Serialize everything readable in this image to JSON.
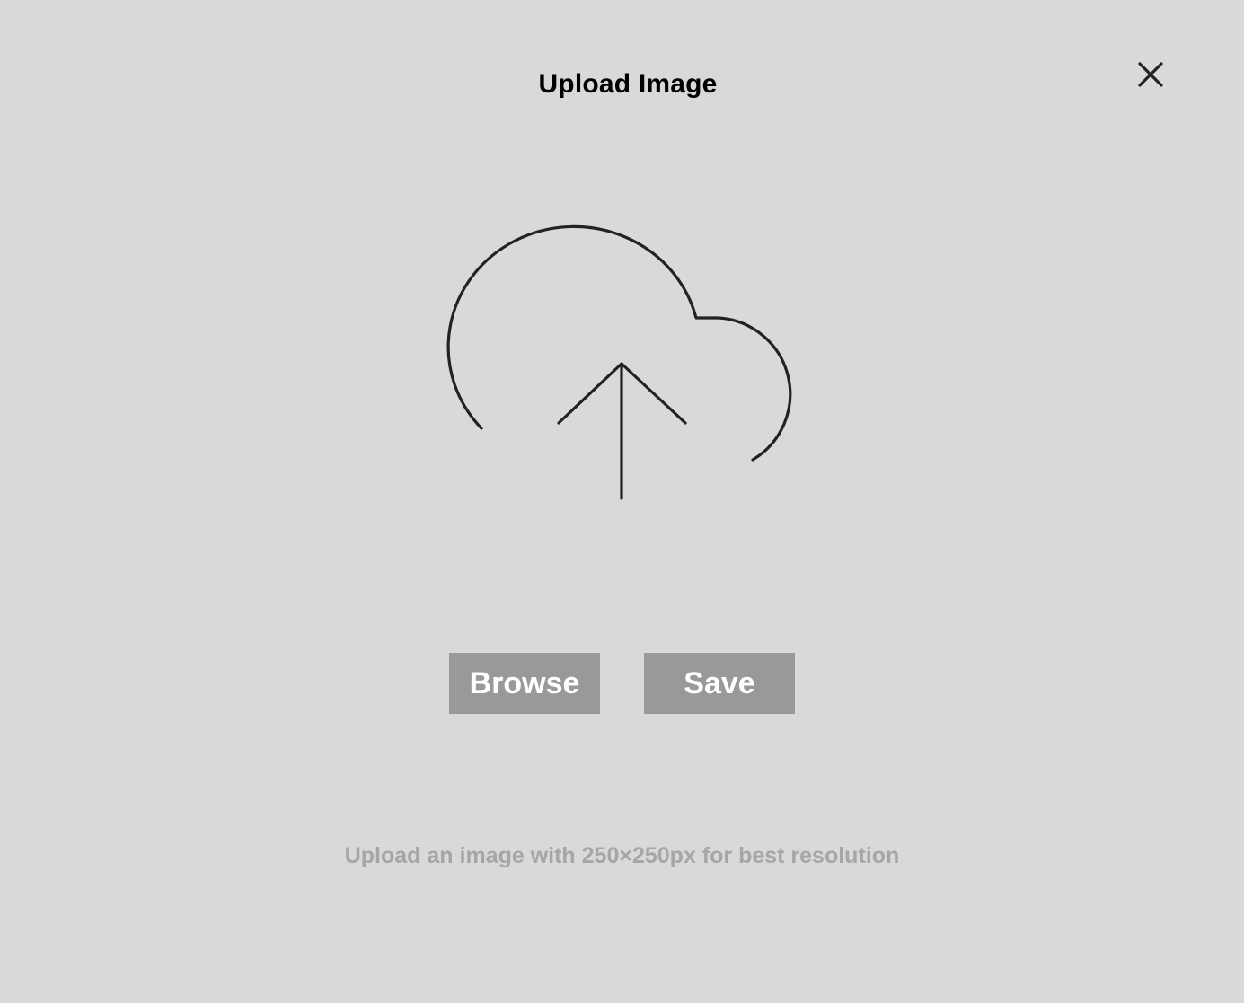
{
  "dialog": {
    "title": "Upload Image",
    "close_icon": "close-icon",
    "upload_icon": "cloud-upload-icon",
    "browse_label": "Browse",
    "save_label": "Save",
    "hint": "Upload an image with 250×250px for best resolution"
  },
  "colors": {
    "background": "#d9d9d9",
    "button_bg": "#999999",
    "button_text": "#ffffff",
    "hint_text": "#a6a6a6",
    "icon_stroke": "#222222"
  }
}
